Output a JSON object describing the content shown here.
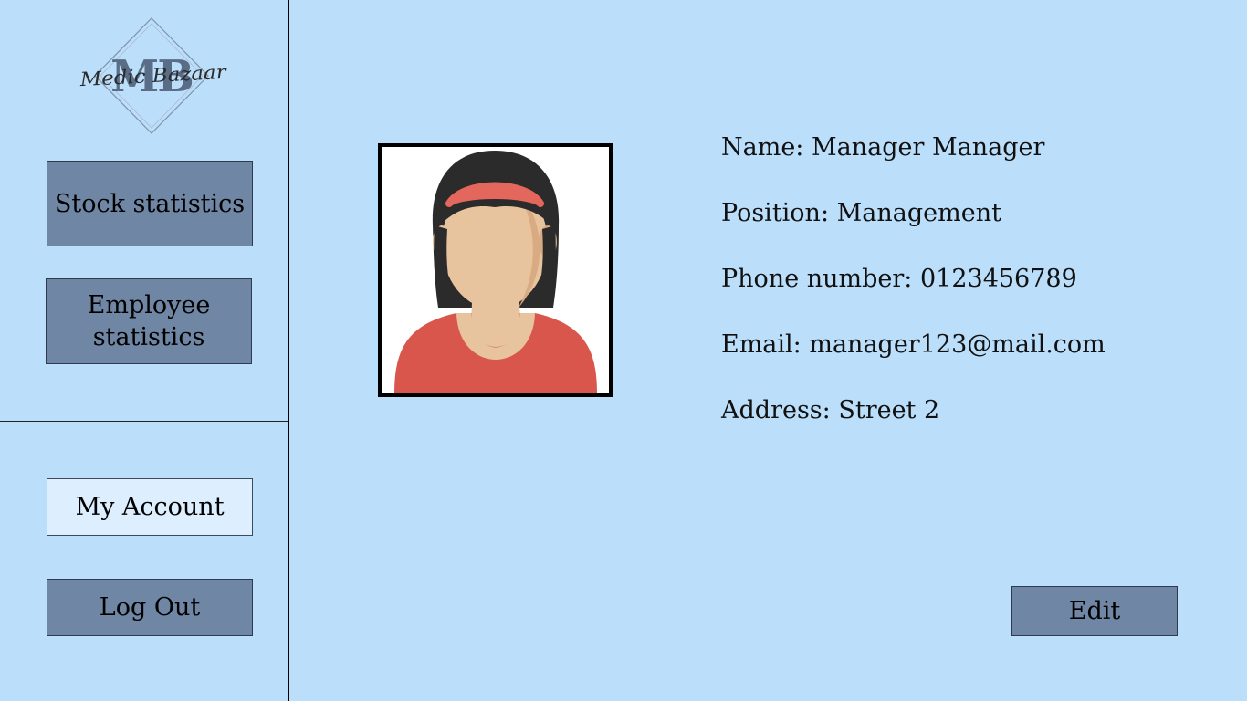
{
  "logo": {
    "monogram": "MB",
    "script_text": "Medic Bazaar"
  },
  "sidebar": {
    "buttons": [
      {
        "label": "Stock statistics"
      },
      {
        "label": "Employee statistics"
      }
    ],
    "account_label": "My Account",
    "logout_label": "Log Out"
  },
  "profile": {
    "name": "Name: Manager Manager",
    "position": "Position: Management",
    "phone": "Phone number: 0123456789",
    "email": "Email: manager123@mail.com",
    "address": "Address: Street 2"
  },
  "actions": {
    "edit_label": "Edit"
  },
  "colors": {
    "background": "#bbdefb",
    "button": "#6f86a4",
    "button_active": "#ddeeff"
  },
  "icons": {
    "avatar": "female-avatar-icon",
    "logo": "mb-diamond-logo"
  }
}
